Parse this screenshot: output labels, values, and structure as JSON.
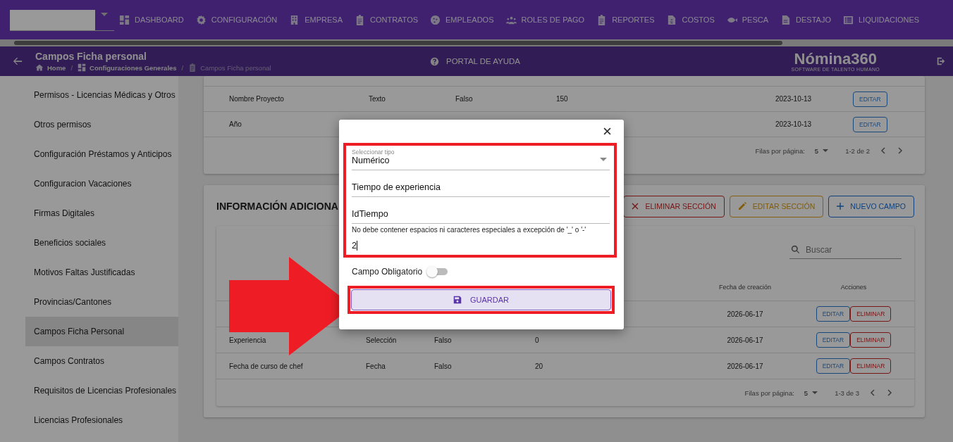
{
  "top_nav": {
    "items": [
      {
        "label": "DASHBOARD"
      },
      {
        "label": "CONFIGURACIÓN"
      },
      {
        "label": "EMPRESA"
      },
      {
        "label": "CONTRATOS"
      },
      {
        "label": "EMPLEADOS"
      },
      {
        "label": "ROLES DE PAGO"
      },
      {
        "label": "REPORTES"
      },
      {
        "label": "COSTOS"
      },
      {
        "label": "PESCA"
      },
      {
        "label": "DESTAJO"
      },
      {
        "label": "LIQUIDACIONES"
      }
    ]
  },
  "header": {
    "title": "Campos Ficha personal",
    "breadcrumb_separator": "/",
    "breadcrumb": [
      {
        "label": "Home",
        "current": false
      },
      {
        "label": "Configuraciones Generales",
        "current": false
      },
      {
        "label": "Campos Ficha personal",
        "current": true
      }
    ],
    "help": "PORTAL DE AYUDA",
    "logo": "Nómina360",
    "logo_tagline": "SOFTWARE DE TALENTO HUMANO"
  },
  "sidebar": {
    "items": [
      {
        "label": "Permisos - Licencias Médicas y Otros",
        "selected": false
      },
      {
        "label": "Otros permisos",
        "selected": false
      },
      {
        "label": "Configuración Préstamos y Anticipos",
        "selected": false
      },
      {
        "label": "Configuracion Vacaciones",
        "selected": false
      },
      {
        "label": "Firmas Digitales",
        "selected": false
      },
      {
        "label": "Beneficios sociales",
        "selected": false
      },
      {
        "label": "Motivos Faltas Justificadas",
        "selected": false
      },
      {
        "label": "Provincias/Cantones",
        "selected": false
      },
      {
        "label": "Campos Ficha Personal",
        "selected": true
      },
      {
        "label": "Campos Contratos",
        "selected": false
      },
      {
        "label": "Requisitos de Licencias Profesionales",
        "selected": false
      },
      {
        "label": "Licencias Profesionales",
        "selected": false
      }
    ]
  },
  "table_1": {
    "rows": [
      {
        "name": "Nombre Proyecto",
        "type": "Texto",
        "required": "Falso",
        "length": "150",
        "date": "2023-10-13",
        "edit": "EDITAR"
      },
      {
        "name": "Año",
        "date": "2023-10-13",
        "edit": "EDITAR"
      }
    ],
    "footer": {
      "rows_label": "Filas por página:",
      "rows_value": "5",
      "range": "1-2 de 2"
    }
  },
  "section_2": {
    "title": "INFORMACIÓN ADICIONA",
    "buttons": [
      {
        "label": "ELIMINAR SECCIÓN",
        "kind": "delete"
      },
      {
        "label": "EDITAR SECCIÓN",
        "kind": "edit"
      },
      {
        "label": "NUEVO CAMPO",
        "kind": "add"
      }
    ],
    "search": {
      "placeholder": "Buscar"
    },
    "columns": [
      {
        "label": "Fecha de creación"
      },
      {
        "label": "Acciones"
      }
    ],
    "rows": [
      {
        "date": "2026-06-17",
        "edit": "EDITAR",
        "delete": "ELIMINAR"
      },
      {
        "name": "Experiencia",
        "type": "Selección",
        "required": "Falso",
        "length": "0",
        "date": "2026-06-17",
        "edit": "EDITAR",
        "delete": "ELIMINAR"
      },
      {
        "name": "Fecha de curso de chef",
        "type": "Fecha",
        "required": "Falso",
        "length": "20",
        "date": "2026-06-17",
        "edit": "EDITAR",
        "delete": "ELIMINAR"
      }
    ],
    "footer": {
      "rows_label": "Filas por página:",
      "rows_value": "5",
      "range": "1-3 de 3"
    }
  },
  "dialog": {
    "type_label": "Seleccionar tipo",
    "type_value": "Numérico",
    "name_value": "Tiempo de experiencia",
    "id_value": "IdTiempo",
    "id_hint": "No debe contener espacios ni caracteres especiales a excepción de '_' o '-'",
    "length_value": "2",
    "required_label": "Campo Obligatorio",
    "required_on": false,
    "save": "GUARDAR"
  }
}
